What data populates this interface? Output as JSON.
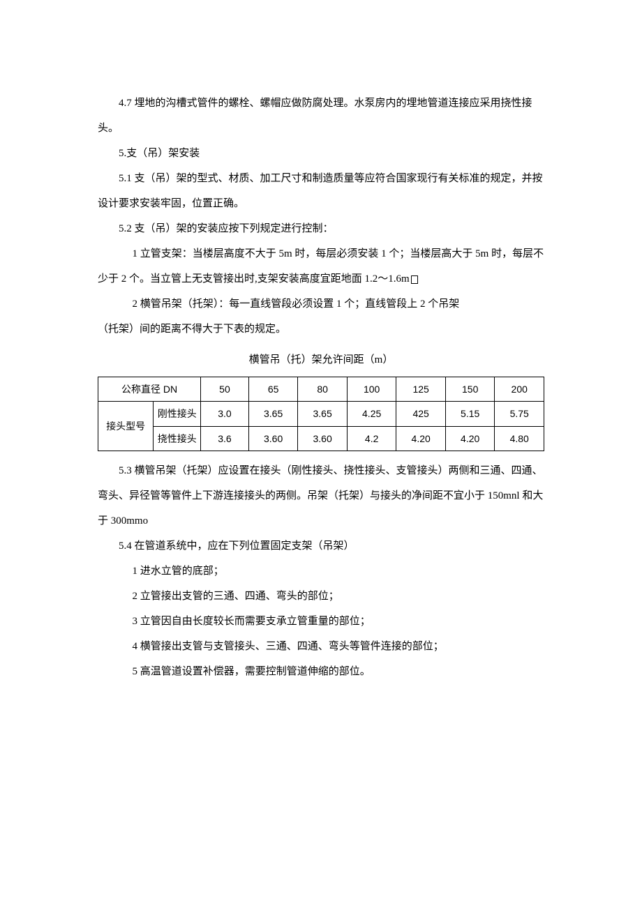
{
  "p1": "4.7 埋地的沟槽式管件的螺栓、螺帽应做防腐处理。水泵房内的埋地管道连接应采用挠性接头。",
  "p2": "5.支（吊）架安装",
  "p3": "5.1 支（吊）架的型式、材质、加工尺寸和制造质量等应符合国家现行有关标准的规定，并按设计要求安装牢固，位置正确。",
  "p4": "5.2 支（吊）架的安装应按下列规定进行控制：",
  "p5": "1 立管支架：当楼层高度不大于 5m 时，每层必须安装 1 个；当楼层高大于 5m 时，每层不少于 2 个。当立管上无支管接出时,支架安装高度宜距地面 1.2～1.6m",
  "p6": "2 横管吊架（托架）：每一直线管段必须设置 1 个；直线管段上 2 个吊架",
  "p6b": "（托架）间的距离不得大于下表的规定。",
  "tableCaption": "横管吊（托）架允许间距（m）",
  "table": {
    "header1": "公称直径 DN",
    "cols": [
      "50",
      "65",
      "80",
      "100",
      "125",
      "150",
      "200"
    ],
    "rowLabel": "接头型号",
    "row1Label": "刚性接头",
    "row1": [
      "3.0",
      "3.65",
      "3.65",
      "4.25",
      "425",
      "5.15",
      "5.75"
    ],
    "row2Label": "挠性接头",
    "row2": [
      "3.6",
      "3.60",
      "3.60",
      "4.2",
      "4.20",
      "4.20",
      "4.80"
    ]
  },
  "p7": "5.3 横管吊架（托架）应设置在接头（刚性接头、挠性接头、支管接头）两侧和三通、四通、弯头、异径管等管件上下游连接接头的两侧。吊架（托架）与接头的净间距不宜小于 150mnl 和大于 300mmo",
  "p8": "5.4 在管道系统中，应在下列位置固定支架（吊架）",
  "li1": "1 进水立管的底部；",
  "li2": "2 立管接出支管的三通、四通、弯头的部位；",
  "li3": "3 立管因自由长度较长而需要支承立管重量的部位；",
  "li4": "4 横管接出支管与支管接头、三通、四通、弯头等管件连接的部位；",
  "li5": "5 高温管道设置补偿器，需要控制管道伸缩的部位。"
}
